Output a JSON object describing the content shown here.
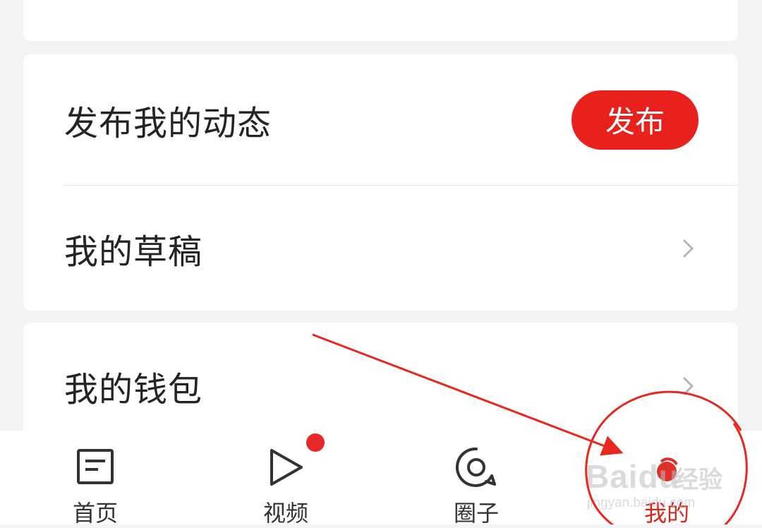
{
  "menu": {
    "publish_label": "发布我的动态",
    "publish_button": "发布",
    "drafts_label": "我的草稿",
    "wallet_label": "我的钱包"
  },
  "tabbar": {
    "tabs": [
      {
        "label": "首页",
        "icon": "document-icon",
        "active": false
      },
      {
        "label": "视频",
        "icon": "play-icon",
        "active": false,
        "badge": true
      },
      {
        "label": "圈子",
        "icon": "circle-chat-icon",
        "active": false
      },
      {
        "label": "我的",
        "icon": "profile-icon",
        "active": true
      }
    ]
  },
  "annotation": {
    "color": "#e8281f",
    "target": "tab-me"
  },
  "watermark": {
    "brand": "Baidu",
    "brand_cn": "经验",
    "url": "jingyan.baidu.com"
  },
  "colors": {
    "accent": "#e8211c",
    "active_tab": "#d8261f",
    "background": "#f3f3f4"
  }
}
